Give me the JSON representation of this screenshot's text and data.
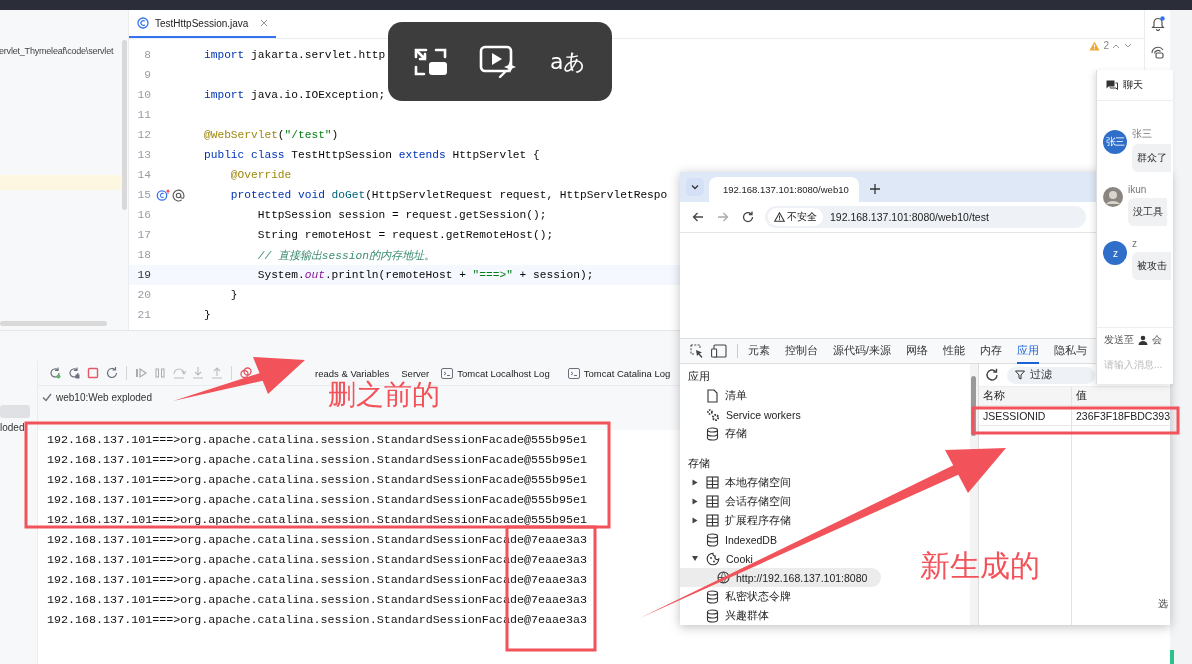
{
  "ide": {
    "project_path": "ervlet_Thymeleaf\\code\\servlet",
    "editor_tab": "TestHttpSession.java",
    "warning_count": "2",
    "code_lines": [
      {
        "number": "8",
        "current": false,
        "segments": [
          {
            "kind": "keyword",
            "text": "import"
          },
          {
            "kind": "plain",
            "text": " jakarta.servlet.http"
          }
        ]
      },
      {
        "number": "9",
        "current": false
      },
      {
        "number": "10",
        "current": false,
        "segments": [
          {
            "kind": "keyword",
            "text": "import"
          },
          {
            "kind": "plain",
            "text": " java.io.IOException;"
          }
        ]
      },
      {
        "number": "11",
        "current": false
      },
      {
        "number": "12",
        "current": false,
        "segments": [
          {
            "kind": "annotation",
            "text": "@WebServlet"
          },
          {
            "kind": "plain",
            "text": "("
          },
          {
            "kind": "string",
            "text": "\"/test\""
          },
          {
            "kind": "plain",
            "text": ")"
          }
        ]
      },
      {
        "number": "13",
        "current": false,
        "segments": [
          {
            "kind": "keyword",
            "text": "public class"
          },
          {
            "kind": "plain",
            "text": " TestHttpSession "
          },
          {
            "kind": "keyword",
            "text": "extends"
          },
          {
            "kind": "plain",
            "text": " HttpServlet {"
          }
        ]
      },
      {
        "number": "14",
        "current": false,
        "segments": [
          {
            "kind": "annotation",
            "text": "    @Override"
          }
        ]
      },
      {
        "number": "15",
        "current": false,
        "gutter_icons": true,
        "segments": [
          {
            "kind": "keyword",
            "text": "    protected void "
          },
          {
            "kind": "method",
            "text": "doGet"
          },
          {
            "kind": "plain",
            "text": "(HttpServletRequest request, HttpServletRespo"
          }
        ]
      },
      {
        "number": "16",
        "current": false,
        "segments": [
          {
            "kind": "plain",
            "text": "        HttpSession session = request.getSession();"
          }
        ]
      },
      {
        "number": "17",
        "current": false,
        "segments": [
          {
            "kind": "plain",
            "text": "        String remoteHost = request.getRemoteHost();"
          }
        ]
      },
      {
        "number": "18",
        "current": false,
        "segments": [
          {
            "kind": "comment",
            "text": "        // 直接输出session的内存地址。"
          }
        ]
      },
      {
        "number": "19",
        "current": true,
        "segments": [
          {
            "kind": "plain",
            "text": "        System."
          },
          {
            "kind": "field",
            "text": "out"
          },
          {
            "kind": "plain",
            "text": ".println(remoteHost + "
          },
          {
            "kind": "string",
            "text": "\"===>\""
          },
          {
            "kind": "plain",
            "text": " + session);"
          }
        ]
      },
      {
        "number": "20",
        "current": false,
        "segments": [
          {
            "kind": "plain",
            "text": "    }"
          }
        ]
      },
      {
        "number": "21",
        "current": false,
        "segments": [
          {
            "kind": "plain",
            "text": "}"
          }
        ]
      }
    ]
  },
  "video_overlay": {
    "translate_glyph": "aあ"
  },
  "run_panel": {
    "side_item": "loded",
    "config": "web10:Web exploded",
    "tabs": [
      {
        "label": "reads & Variables",
        "kind": "plain",
        "selected": false
      },
      {
        "label": "Server",
        "kind": "plain",
        "selected": false
      },
      {
        "label": "Tomcat Localhost Log",
        "kind": "log",
        "selected": false
      },
      {
        "label": "Tomcat Catalina Log",
        "kind": "log",
        "selected": false
      }
    ],
    "console": [
      "192.168.137.101===>org.apache.catalina.session.StandardSessionFacade@555b95e1",
      "192.168.137.101===>org.apache.catalina.session.StandardSessionFacade@555b95e1",
      "192.168.137.101===>org.apache.catalina.session.StandardSessionFacade@555b95e1",
      "192.168.137.101===>org.apache.catalina.session.StandardSessionFacade@555b95e1",
      "192.168.137.101===>org.apache.catalina.session.StandardSessionFacade@555b95e1",
      "192.168.137.101===>org.apache.catalina.session.StandardSessionFacade@7eaae3a3",
      "192.168.137.101===>org.apache.catalina.session.StandardSessionFacade@7eaae3a3",
      "192.168.137.101===>org.apache.catalina.session.StandardSessionFacade@7eaae3a3",
      "192.168.137.101===>org.apache.catalina.session.StandardSessionFacade@7eaae3a3",
      "192.168.137.101===>org.apache.catalina.session.StandardSessionFacade@7eaae3a3"
    ]
  },
  "browser": {
    "tab_title": "192.168.137.101:8080/web10",
    "security_label": "不安全",
    "url": "192.168.137.101:8080/web10/test",
    "devtools": {
      "tabs": [
        {
          "label": "元素",
          "selected": false
        },
        {
          "label": "控制台",
          "selected": false
        },
        {
          "label": "源代码/来源",
          "selected": false
        },
        {
          "label": "网络",
          "selected": false
        },
        {
          "label": "性能",
          "selected": false
        },
        {
          "label": "内存",
          "selected": false
        },
        {
          "label": "应用",
          "selected": true
        },
        {
          "label": "隐私与",
          "selected": false
        }
      ],
      "sidebar": [
        {
          "kind": "header",
          "label": "应用"
        },
        {
          "kind": "manifest",
          "label": "清单",
          "selected": false
        },
        {
          "kind": "workers",
          "label": "Service workers",
          "selected": false
        },
        {
          "kind": "database",
          "label": "存储",
          "selected": false
        },
        {
          "kind": "header",
          "label": "存储"
        },
        {
          "kind": "table",
          "label": "本地存储空间",
          "expanded": false,
          "selected": false
        },
        {
          "kind": "table",
          "label": "会话存储空间",
          "expanded": false,
          "selected": false
        },
        {
          "kind": "table",
          "label": "扩展程序存储",
          "expanded": false,
          "selected": false
        },
        {
          "kind": "database",
          "label": "IndexedDB",
          "selected": false
        },
        {
          "kind": "cookie",
          "label": "Cooki",
          "expanded": true,
          "selected": false,
          "children": [
            {
              "kind": "origin",
              "label": "http://192.168.137.101:8080",
              "selected": true
            }
          ]
        },
        {
          "kind": "database",
          "label": "私密状态令牌",
          "selected": false
        },
        {
          "kind": "database",
          "label": "兴趣群体",
          "selected": false
        }
      ],
      "filter_placeholder": "过滤",
      "columns": [
        "名称",
        "值"
      ],
      "rows": [
        [
          "JSESSIONID",
          "236F3F18FBDC393"
        ]
      ],
      "footer_text": "选"
    }
  },
  "chat": {
    "title": "聊天",
    "messages": [
      {
        "sender": "张三",
        "kind": "initials",
        "avatar_text": "张三",
        "text": "群众了"
      },
      {
        "sender": "ikun",
        "kind": "picture",
        "text": "没工具"
      },
      {
        "sender": "z",
        "kind": "initials",
        "avatar_text": "z",
        "text": "被攻击"
      }
    ],
    "send_to_label": "发送至",
    "send_to_target": "会",
    "input_placeholder": "请输入消息..."
  },
  "annotations": [
    "删之前的",
    "新生成的"
  ]
}
